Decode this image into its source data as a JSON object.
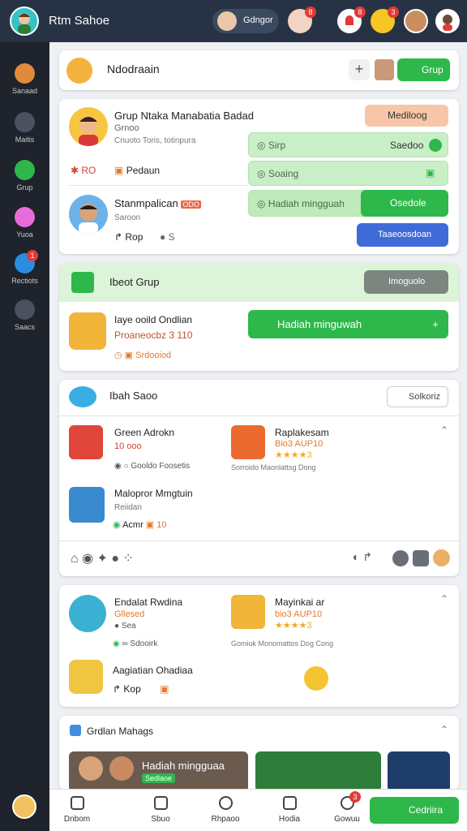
{
  "header": {
    "title": "Rtm Sahoe",
    "user_chip": "Gdngor",
    "badges": [
      "8",
      "3"
    ]
  },
  "sidebar": {
    "items": [
      {
        "label": "Sanaad",
        "icon": "home-icon"
      },
      {
        "label": "Maitis",
        "icon": "chat-icon"
      },
      {
        "label": "Grup",
        "icon": "group-icon"
      },
      {
        "label": "Yuoa",
        "icon": "mascot-icon"
      },
      {
        "label": "Rectiots",
        "icon": "notifications-icon",
        "badge": "1"
      },
      {
        "label": "Saacs",
        "icon": "settings-icon"
      }
    ]
  },
  "top_card": {
    "title": "Ndodraain",
    "add": "+",
    "action": "Grup"
  },
  "profile_card": {
    "name": "Grup Ntaka Manabatia Badad",
    "subtitle": "Grnoo",
    "meta": "Cnuoto Toris, totinpura",
    "stat1": "RO",
    "stat2": "Pedaun",
    "green_btn": "Mediloog",
    "row1_label": "Sirp",
    "row1_value": "Saedoo",
    "row2_label": "Soaing",
    "row3_label": "Hadiah mingguah",
    "row3_value": "Osedole",
    "person2_name": "Stanmpalican",
    "person2_tag": "ODO",
    "person2_sub": "Saroon",
    "person2_stat1": "Rop",
    "person2_stat2": "S",
    "blue_btn": "Taaeoosdoan"
  },
  "group_card": {
    "title": "Ibeot Grup",
    "gray_btn": "Imoguolo",
    "item_name": "Iaye ooild Ondlian",
    "item_price": "Proaneocbz 3 110",
    "item_status": "Srdooiod",
    "cta": "Hadiah minguwah",
    "cta_icon": "+"
  },
  "list_card": {
    "title": "Ibah Saoo",
    "action": "Solkoriz",
    "items": [
      {
        "name": "Green Adrokn",
        "price": "10 ooo",
        "meta": "Gooldo Foosetis"
      },
      {
        "name": "Raplakesam",
        "price": "Bio3 AUP10",
        "rating": "3",
        "meta": "Sorroido Maonlattsg Dong"
      },
      {
        "name": "Malopror Mmgtuin",
        "sub": "Reiidan",
        "stat1": "Acmr",
        "stat2": "10"
      }
    ]
  },
  "list_card2": {
    "items": [
      {
        "name": "Endalat Rwdina",
        "sub": "Gllesed",
        "meta": "Sea",
        "extra": "Sdooirk"
      },
      {
        "name": "Mayinkai ar",
        "price": "bio3 AUP10",
        "rating": "3",
        "meta": "Gomiuk Monomattos Dog Cong"
      },
      {
        "name": "Aagiatian Ohadiaa",
        "stat": "Kop"
      }
    ]
  },
  "media_card": {
    "title": "Grdlan Mahags",
    "tile1_title": "Hadiah mingguaa",
    "tile1_sub": "Sedlaoe"
  },
  "bottom_nav": {
    "items": [
      "Dnbom",
      "Sbuo",
      "Rhpaoo",
      "Hodia",
      "Gowuu"
    ],
    "badge": "3",
    "action": "Cedriira"
  },
  "colors": {
    "accent_green": "#2eb84b",
    "accent_blue": "#3f6bd8",
    "topbar": "#273345",
    "sidebar": "#1e232c"
  }
}
